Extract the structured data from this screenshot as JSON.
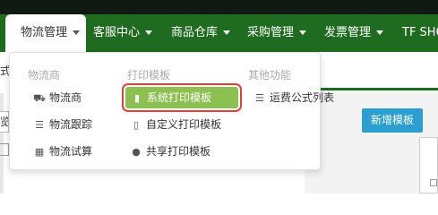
{
  "nav": {
    "tabs": [
      {
        "label": "物流管理"
      },
      {
        "label": "客服中心"
      },
      {
        "label": "商品仓库"
      },
      {
        "label": "采购管理"
      },
      {
        "label": "发票管理"
      },
      {
        "label": "TF SHOP"
      }
    ]
  },
  "background": {
    "left_text": "式",
    "left_input": "览",
    "new_template_button": "新增模板"
  },
  "dropdown": {
    "columns": [
      {
        "title": "物流商",
        "items": [
          {
            "label": "物流商",
            "icon": "truck-icon",
            "glyph": "⛟"
          },
          {
            "label": "物流跟踪",
            "icon": "list-icon",
            "glyph": "☰"
          },
          {
            "label": "物流试算",
            "icon": "table-icon",
            "glyph": "▦"
          }
        ]
      },
      {
        "title": "打印模板",
        "items": [
          {
            "label": "系统打印模板",
            "icon": "bookmark-icon",
            "glyph": "🔖"
          },
          {
            "label": "自定义打印模板",
            "icon": "bookmark-outline-icon",
            "glyph": "⛉"
          },
          {
            "label": "共享打印模板",
            "icon": "users-icon",
            "glyph": "👥"
          }
        ]
      },
      {
        "title": "其他功能",
        "items": [
          {
            "label": "运费公式列表",
            "icon": "list-icon",
            "glyph": "☰"
          }
        ]
      }
    ]
  },
  "colors": {
    "nav_bg": "#1f6b1f",
    "highlight_bg": "#8cc152",
    "highlight_outline": "#e0403a",
    "button_blue": "#2b9fcf"
  }
}
